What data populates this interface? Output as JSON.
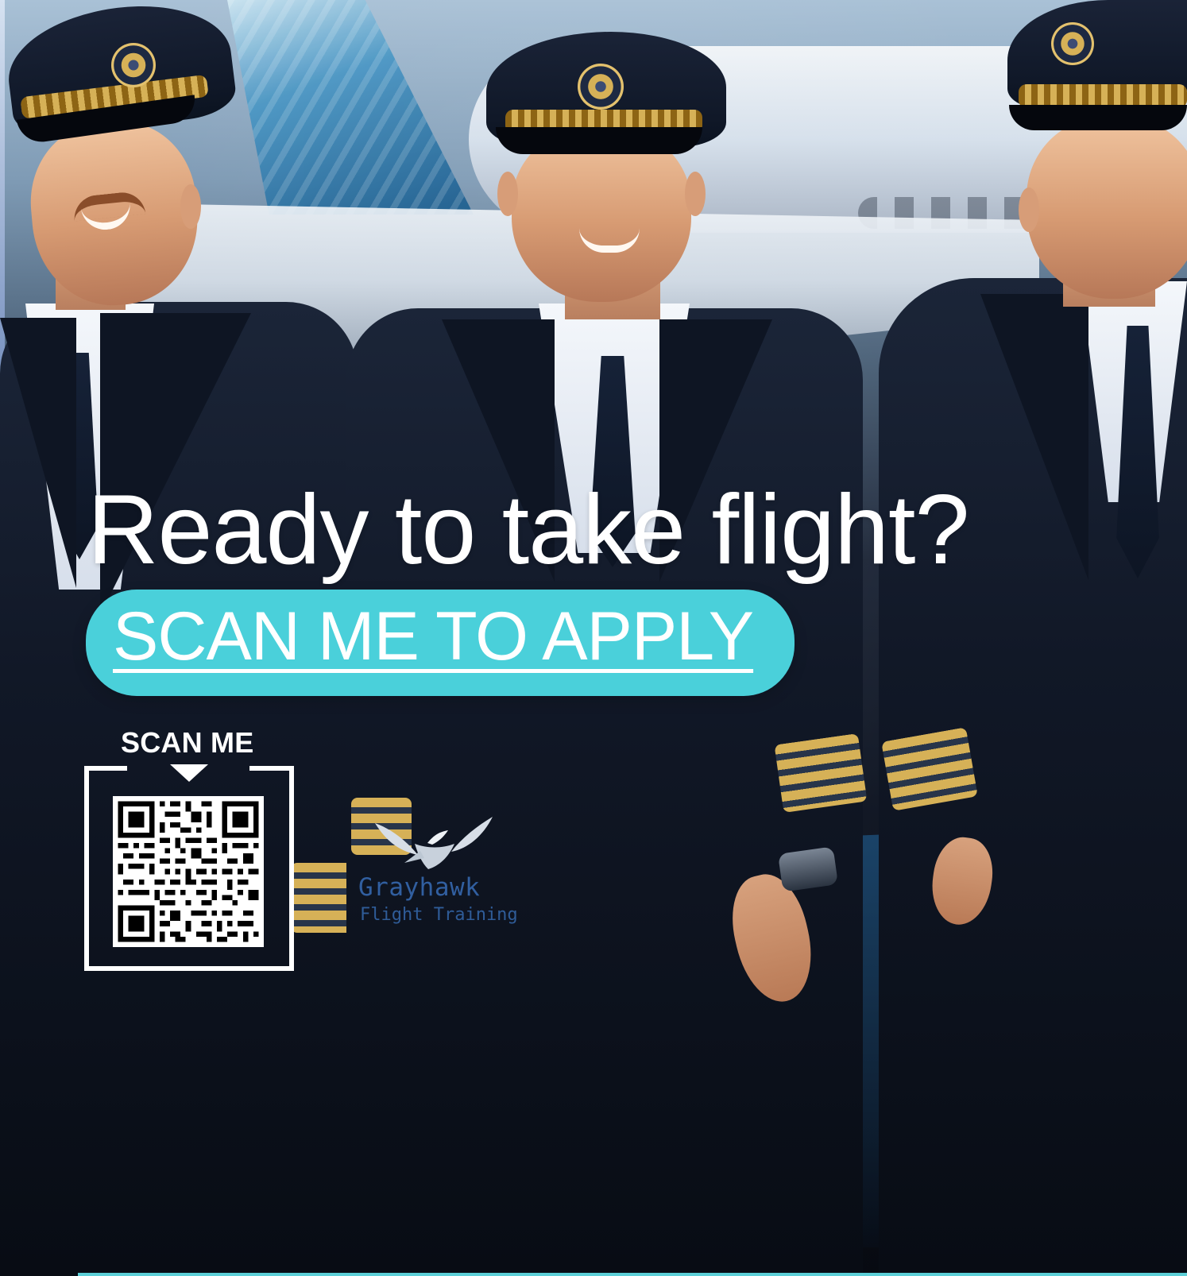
{
  "hero": {
    "headline": "Ready to take flight?",
    "cta_label": "SCAN ME TO APPLY"
  },
  "qr": {
    "label": "SCAN ME"
  },
  "brand": {
    "name": "Grayhawk",
    "subtitle": "Flight Training"
  },
  "colors": {
    "accent": "#4ad0da",
    "brand_blue": "#315fa0",
    "text": "#ffffff"
  },
  "icons": {
    "cta_arrow": "chevron-down-icon",
    "logo": "hawk-logo-icon",
    "qr": "qr-code-icon"
  }
}
